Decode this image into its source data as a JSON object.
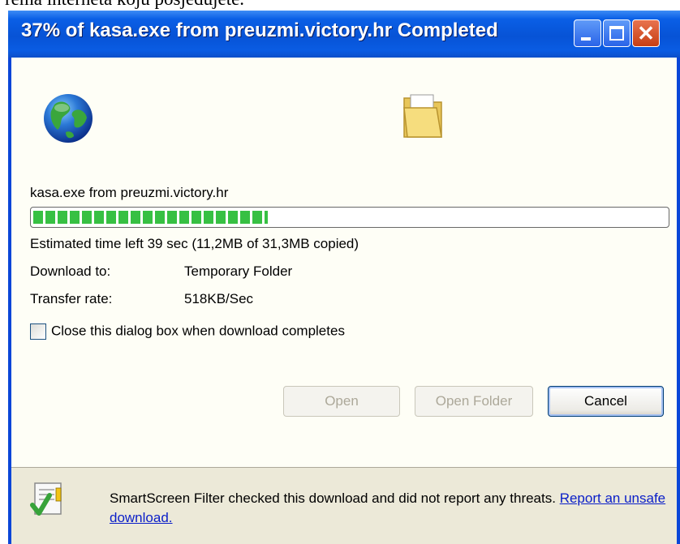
{
  "background": {
    "text": "rema interneta koju posjedujete."
  },
  "window": {
    "title": "37% of kasa.exe from preuzmi.victory.hr Completed",
    "controls": {
      "minimize": "minimize",
      "maximize": "maximize",
      "close": "✕"
    }
  },
  "download": {
    "file_label": "kasa.exe from preuzmi.victory.hr",
    "progress_percent": 37,
    "estimated_label": "Estimated time left",
    "estimated_value": "39 sec (11,2MB of 31,3MB copied)",
    "download_to_label": "Download to:",
    "download_to_value": "Temporary Folder",
    "transfer_rate_label": "Transfer rate:",
    "transfer_rate_value": "518KB/Sec",
    "close_checkbox_label": "Close this dialog box when download completes",
    "close_checkbox_checked": false
  },
  "buttons": {
    "open": "Open",
    "open_folder": "Open Folder",
    "cancel": "Cancel"
  },
  "smartscreen": {
    "message": "SmartScreen Filter checked this download and did not report any threats.",
    "link": "Report an unsafe download."
  },
  "icons": {
    "globe": "globe-icon",
    "folder": "folder-icon",
    "shield": "smartscreen-check-icon"
  },
  "colors": {
    "titlebar": "#0753d6",
    "progress": "#37c043",
    "link": "#0a1ec8",
    "dialog": "#ece9d8"
  }
}
